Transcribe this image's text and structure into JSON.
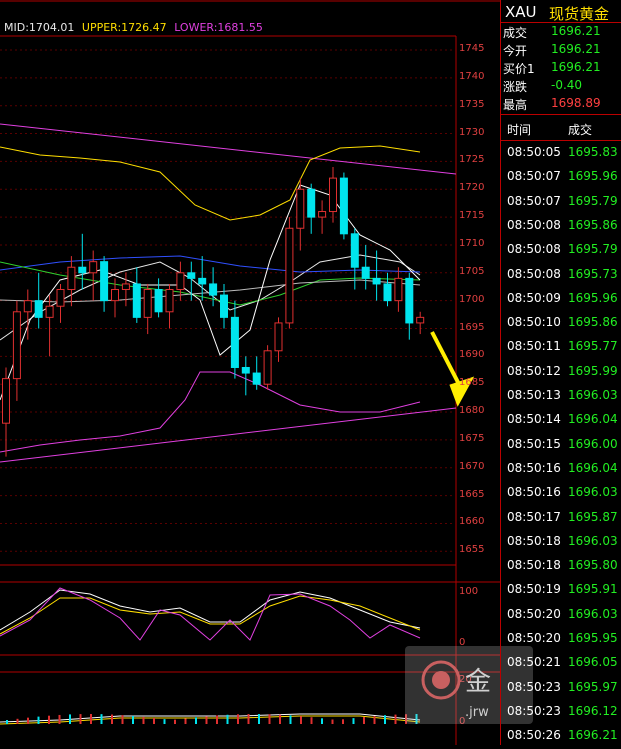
{
  "header": {
    "mid": "MID:1704.01",
    "upper": "UPPER:1726.47",
    "lower": "LOWER:1681.55"
  },
  "colors": {
    "mid": "#e8e8e8",
    "upper": "#ffde00",
    "lower": "#e040e0",
    "up": "#e03030",
    "down": "#00e5ee",
    "grid": "#b00000",
    "price_green": "#22ee22"
  },
  "price_axis": [
    "1745",
    "1740",
    "1735",
    "1730",
    "1725",
    "1720",
    "1715",
    "1710",
    "1705",
    "1700",
    "1695",
    "1690",
    "1685",
    "1680",
    "1675",
    "1670",
    "1665",
    "1660",
    "1655"
  ],
  "osc_axis_1": [
    "100",
    "0"
  ],
  "osc_axis_2": [
    "20",
    "0"
  ],
  "panel": {
    "symbol": "XAU",
    "name": "现货黄金",
    "quotes": [
      {
        "label": "成交",
        "value": "1696.21",
        "color": "#22ee22"
      },
      {
        "label": "今开",
        "value": "1696.21",
        "color": "#22ee22"
      },
      {
        "label": "买价1",
        "value": "1696.21",
        "color": "#22ee22"
      },
      {
        "label": "涨跌",
        "value": "-0.40",
        "color": "#22ee22"
      },
      {
        "label": "最高",
        "value": "1698.89",
        "color": "#ff4040"
      }
    ],
    "trade_header": {
      "time": "时间",
      "price": "成交"
    },
    "trades": [
      {
        "time": "08:50:05",
        "price": "1695.83"
      },
      {
        "time": "08:50:07",
        "price": "1695.96"
      },
      {
        "time": "08:50:07",
        "price": "1695.79"
      },
      {
        "time": "08:50:08",
        "price": "1695.86"
      },
      {
        "time": "08:50:08",
        "price": "1695.79"
      },
      {
        "time": "08:50:08",
        "price": "1695.73"
      },
      {
        "time": "08:50:09",
        "price": "1695.96"
      },
      {
        "time": "08:50:10",
        "price": "1695.86"
      },
      {
        "time": "08:50:11",
        "price": "1695.77"
      },
      {
        "time": "08:50:12",
        "price": "1695.99"
      },
      {
        "time": "08:50:13",
        "price": "1696.03"
      },
      {
        "time": "08:50:14",
        "price": "1696.04"
      },
      {
        "time": "08:50:15",
        "price": "1696.00"
      },
      {
        "time": "08:50:16",
        "price": "1696.04"
      },
      {
        "time": "08:50:16",
        "price": "1696.03"
      },
      {
        "time": "08:50:17",
        "price": "1695.87"
      },
      {
        "time": "08:50:18",
        "price": "1696.03"
      },
      {
        "time": "08:50:18",
        "price": "1695.80"
      },
      {
        "time": "08:50:19",
        "price": "1695.91"
      },
      {
        "time": "08:50:20",
        "price": "1696.03"
      },
      {
        "time": "08:50:20",
        "price": "1695.95"
      },
      {
        "time": "08:50:21",
        "price": "1696.05"
      },
      {
        "time": "08:50:23",
        "price": "1695.97"
      },
      {
        "time": "08:50:23",
        "price": "1696.12"
      },
      {
        "time": "08:50:26",
        "price": "1696.21"
      }
    ]
  },
  "candles": [
    {
      "o": 1678,
      "h": 1688,
      "l": 1672,
      "c": 1686
    },
    {
      "o": 1686,
      "h": 1700,
      "l": 1682,
      "c": 1698
    },
    {
      "o": 1698,
      "h": 1702,
      "l": 1693,
      "c": 1700
    },
    {
      "o": 1700,
      "h": 1705,
      "l": 1695,
      "c": 1697
    },
    {
      "o": 1697,
      "h": 1701,
      "l": 1690,
      "c": 1699
    },
    {
      "o": 1699,
      "h": 1703,
      "l": 1696,
      "c": 1702
    },
    {
      "o": 1702,
      "h": 1708,
      "l": 1699,
      "c": 1706
    },
    {
      "o": 1706,
      "h": 1712,
      "l": 1702,
      "c": 1705
    },
    {
      "o": 1705,
      "h": 1709,
      "l": 1700,
      "c": 1707
    },
    {
      "o": 1707,
      "h": 1708,
      "l": 1698,
      "c": 1700
    },
    {
      "o": 1700,
      "h": 1704,
      "l": 1697,
      "c": 1702
    },
    {
      "o": 1702,
      "h": 1705,
      "l": 1699,
      "c": 1703
    },
    {
      "o": 1703,
      "h": 1706,
      "l": 1696,
      "c": 1697
    },
    {
      "o": 1697,
      "h": 1703,
      "l": 1694,
      "c": 1702
    },
    {
      "o": 1702,
      "h": 1704,
      "l": 1697,
      "c": 1698
    },
    {
      "o": 1698,
      "h": 1703,
      "l": 1695,
      "c": 1702
    },
    {
      "o": 1702,
      "h": 1707,
      "l": 1700,
      "c": 1705
    },
    {
      "o": 1705,
      "h": 1707,
      "l": 1700,
      "c": 1704
    },
    {
      "o": 1704,
      "h": 1708,
      "l": 1700,
      "c": 1703
    },
    {
      "o": 1703,
      "h": 1706,
      "l": 1699,
      "c": 1701
    },
    {
      "o": 1701,
      "h": 1703,
      "l": 1695,
      "c": 1697
    },
    {
      "o": 1697,
      "h": 1700,
      "l": 1686,
      "c": 1688
    },
    {
      "o": 1688,
      "h": 1690,
      "l": 1683,
      "c": 1687
    },
    {
      "o": 1687,
      "h": 1690,
      "l": 1684,
      "c": 1685
    },
    {
      "o": 1685,
      "h": 1692,
      "l": 1684,
      "c": 1691
    },
    {
      "o": 1691,
      "h": 1697,
      "l": 1689,
      "c": 1696
    },
    {
      "o": 1696,
      "h": 1715,
      "l": 1695,
      "c": 1713
    },
    {
      "o": 1713,
      "h": 1722,
      "l": 1709,
      "c": 1720
    },
    {
      "o": 1720,
      "h": 1721,
      "l": 1712,
      "c": 1715
    },
    {
      "o": 1715,
      "h": 1718,
      "l": 1712,
      "c": 1716
    },
    {
      "o": 1716,
      "h": 1724,
      "l": 1714,
      "c": 1722
    },
    {
      "o": 1722,
      "h": 1723,
      "l": 1711,
      "c": 1712
    },
    {
      "o": 1712,
      "h": 1713,
      "l": 1702,
      "c": 1706
    },
    {
      "o": 1706,
      "h": 1710,
      "l": 1702,
      "c": 1704
    },
    {
      "o": 1704,
      "h": 1709,
      "l": 1700,
      "c": 1703
    },
    {
      "o": 1703,
      "h": 1705,
      "l": 1699,
      "c": 1700
    },
    {
      "o": 1700,
      "h": 1706,
      "l": 1698,
      "c": 1704
    },
    {
      "o": 1704,
      "h": 1705,
      "l": 1693,
      "c": 1696
    },
    {
      "o": 1696,
      "h": 1698,
      "l": 1694,
      "c": 1697
    }
  ]
}
